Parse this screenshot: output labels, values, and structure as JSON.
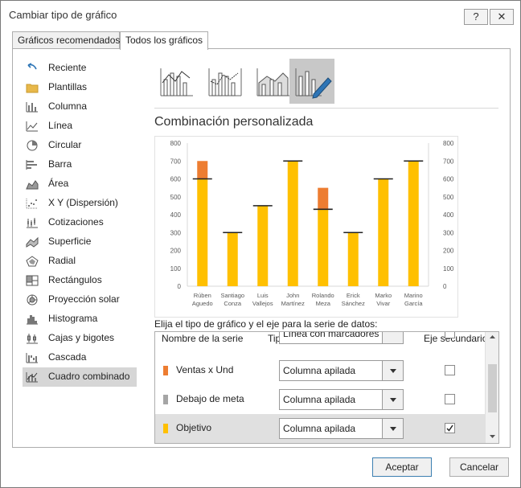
{
  "window": {
    "title": "Cambiar tipo de gráfico",
    "help_label": "?",
    "close_label": "✕"
  },
  "tabs": [
    {
      "label": "Gráficos recomendados"
    },
    {
      "label": "Todos los gráficos"
    }
  ],
  "sidebar": {
    "items": [
      {
        "label": "Reciente",
        "icon": "recent-icon"
      },
      {
        "label": "Plantillas",
        "icon": "folder-icon"
      },
      {
        "label": "Columna",
        "icon": "column-chart-icon"
      },
      {
        "label": "Línea",
        "icon": "line-chart-icon"
      },
      {
        "label": "Circular",
        "icon": "pie-chart-icon"
      },
      {
        "label": "Barra",
        "icon": "bar-chart-icon"
      },
      {
        "label": "Área",
        "icon": "area-chart-icon"
      },
      {
        "label": "X Y (Dispersión)",
        "icon": "scatter-chart-icon"
      },
      {
        "label": "Cotizaciones",
        "icon": "stock-chart-icon"
      },
      {
        "label": "Superficie",
        "icon": "surface-chart-icon"
      },
      {
        "label": "Radial",
        "icon": "radar-chart-icon"
      },
      {
        "label": "Rectángulos",
        "icon": "treemap-icon"
      },
      {
        "label": "Proyección solar",
        "icon": "sunburst-icon"
      },
      {
        "label": "Histograma",
        "icon": "histogram-icon"
      },
      {
        "label": "Cajas y bigotes",
        "icon": "box-whisker-icon"
      },
      {
        "label": "Cascada",
        "icon": "waterfall-icon"
      },
      {
        "label": "Cuadro combinado",
        "icon": "combo-chart-icon"
      }
    ],
    "selected": "Cuadro combinado"
  },
  "main": {
    "combo_title": "Combinación personalizada",
    "series_prompt": "Elija el tipo de gráfico y el eje para la serie de datos:",
    "table_headers": {
      "name": "Nombre de la serie",
      "type": "Tipo de gráfico",
      "secondary": "Eje secundario"
    },
    "rows": [
      {
        "name": "Objetivo",
        "type": "Línea con marcadores",
        "color": "#ffc000",
        "secondary": false,
        "partial": true
      },
      {
        "name": "Ventas x Und",
        "type": "Columna apilada",
        "color": "#ed7d31",
        "secondary": false
      },
      {
        "name": "Debajo de meta",
        "type": "Columna apilada",
        "color": "#a5a5a5",
        "secondary": false
      },
      {
        "name": "Objetivo",
        "type": "Columna apilada",
        "color": "#ffc000",
        "secondary": true
      }
    ]
  },
  "buttons": {
    "ok": "Aceptar",
    "cancel": "Cancelar"
  },
  "chart_data": {
    "type": "bar",
    "categories": [
      "Rúben Aguedo",
      "Santiago Conza",
      "Luis Vallejos",
      "John Martínez",
      "Rolando Meza",
      "Erick Sánchez",
      "Marko Vivar",
      "Marino García"
    ],
    "series": [
      {
        "name": "Objetivo",
        "values": [
          600,
          300,
          450,
          700,
          430,
          300,
          600,
          700
        ],
        "color": "#ffc000"
      },
      {
        "name": "Ventas x Und",
        "values": [
          100,
          0,
          0,
          0,
          120,
          0,
          0,
          0
        ],
        "color": "#ed7d31"
      },
      {
        "name": "Objetivo",
        "values": [
          600,
          300,
          450,
          700,
          430,
          300,
          600,
          700
        ],
        "color": "#222222",
        "line": "marker"
      }
    ],
    "ylim": [
      0,
      800
    ],
    "yticks": [
      0,
      100,
      200,
      300,
      400,
      500,
      600,
      700,
      800
    ],
    "secondary_yticks": [
      0,
      100,
      200,
      300,
      400,
      500,
      600,
      700,
      800
    ],
    "stacked": true
  }
}
